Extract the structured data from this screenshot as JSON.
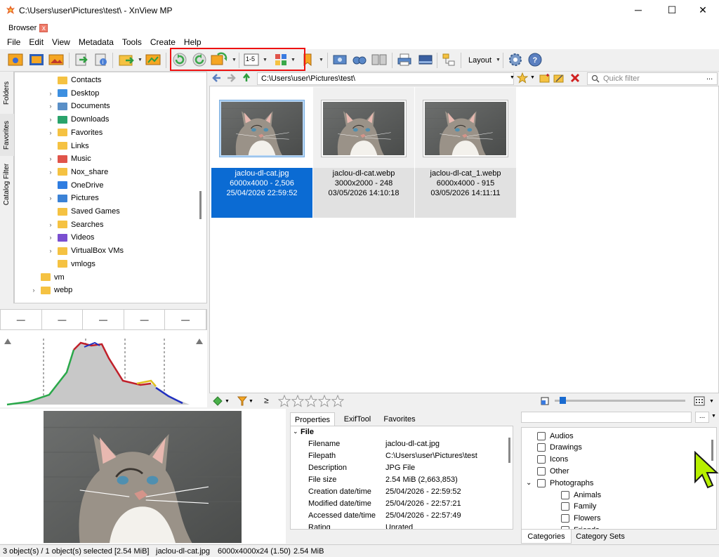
{
  "window": {
    "title": "C:\\Users\\user\\Pictures\\test\\ - XnView MP",
    "minimize": "─",
    "maximize": "☐",
    "close": "✕"
  },
  "tab": {
    "label": "Browser",
    "close": "x"
  },
  "menu": [
    "File",
    "Edit",
    "View",
    "Metadata",
    "Tools",
    "Create",
    "Help"
  ],
  "toolbar": {
    "page_label": "1-5",
    "layout_label": "Layout"
  },
  "left_tabs": [
    "Folders",
    "Favorites",
    "Catalog Filter"
  ],
  "folder_tree": [
    {
      "label": "Contacts",
      "icon": "folder-icon",
      "color": "#f5c242",
      "chevron": ""
    },
    {
      "label": "Desktop",
      "icon": "folder-icon",
      "color": "#3d8fe0",
      "chevron": "›"
    },
    {
      "label": "Documents",
      "icon": "folder-icon",
      "color": "#5a8fc7",
      "chevron": "›"
    },
    {
      "label": "Downloads",
      "icon": "folder-icon",
      "color": "#2aa36b",
      "chevron": "›"
    },
    {
      "label": "Favorites",
      "icon": "folder-icon",
      "color": "#f5c242",
      "chevron": "›"
    },
    {
      "label": "Links",
      "icon": "folder-icon",
      "color": "#f5c242",
      "chevron": ""
    },
    {
      "label": "Music",
      "icon": "folder-icon",
      "color": "#e0544a",
      "chevron": "›"
    },
    {
      "label": "Nox_share",
      "icon": "folder-icon",
      "color": "#f5c242",
      "chevron": "›"
    },
    {
      "label": "OneDrive",
      "icon": "folder-icon",
      "color": "#2f7de1",
      "chevron": ""
    },
    {
      "label": "Pictures",
      "icon": "folder-icon",
      "color": "#3b82d6",
      "chevron": "›"
    },
    {
      "label": "Saved Games",
      "icon": "folder-icon",
      "color": "#f5c242",
      "chevron": ""
    },
    {
      "label": "Searches",
      "icon": "folder-icon",
      "color": "#f5c242",
      "chevron": "›"
    },
    {
      "label": "Videos",
      "icon": "folder-icon",
      "color": "#7a4fd0",
      "chevron": "›"
    },
    {
      "label": "VirtualBox VMs",
      "icon": "folder-icon",
      "color": "#f5c242",
      "chevron": "›"
    },
    {
      "label": "vmlogs",
      "icon": "folder-icon",
      "color": "#f5c242",
      "chevron": ""
    },
    {
      "label": "vm",
      "icon": "folder-icon",
      "color": "#f5c242",
      "chevron": ""
    },
    {
      "label": "webp",
      "icon": "folder-icon",
      "color": "#f5c242",
      "chevron": "›"
    }
  ],
  "histogram_header": [
    "—",
    "—",
    "—",
    "—",
    "—"
  ],
  "address": {
    "path": "C:\\Users\\user\\Pictures\\test\\",
    "filter_placeholder": "Quick filter",
    "more": "..."
  },
  "thumbnails": [
    {
      "name": "jaclou-dl-cat.jpg",
      "dims": "6000x4000 - 2,506",
      "date": "25/04/2026 22:59:52",
      "selected": true
    },
    {
      "name": "jaclou-dl-cat.webp",
      "dims": "3000x2000 - 248",
      "date": "03/05/2026 14:10:18",
      "selected": false
    },
    {
      "name": "jaclou-dl-cat_1.webp",
      "dims": "6000x4000 - 915",
      "date": "03/05/2026 14:11:11",
      "selected": false
    }
  ],
  "rating": {
    "comparator": "≥",
    "stars": 5
  },
  "properties": {
    "tabs": [
      "Properties",
      "ExifTool",
      "Favorites"
    ],
    "section": "File",
    "rows": [
      {
        "key": "Filename",
        "value": "jaclou-dl-cat.jpg"
      },
      {
        "key": "Filepath",
        "value": "C:\\Users\\user\\Pictures\\test"
      },
      {
        "key": "Description",
        "value": "JPG File"
      },
      {
        "key": "File size",
        "value": "2.54 MiB (2,663,853)"
      },
      {
        "key": "Creation date/time",
        "value": "25/04/2026 - 22:59:52"
      },
      {
        "key": "Modified date/time",
        "value": "25/04/2026 - 22:57:21"
      },
      {
        "key": "Accessed date/time",
        "value": "25/04/2026 - 22:57:49"
      },
      {
        "key": "Rating",
        "value": "Unrated"
      }
    ]
  },
  "categories": {
    "more": "...",
    "items": [
      {
        "label": "Audios",
        "child": false,
        "expand": ""
      },
      {
        "label": "Drawings",
        "child": false,
        "expand": ""
      },
      {
        "label": "Icons",
        "child": false,
        "expand": ""
      },
      {
        "label": "Other",
        "child": false,
        "expand": ""
      },
      {
        "label": "Photographs",
        "child": false,
        "expand": "⌄"
      },
      {
        "label": "Animals",
        "child": true,
        "expand": ""
      },
      {
        "label": "Family",
        "child": true,
        "expand": ""
      },
      {
        "label": "Flowers",
        "child": true,
        "expand": ""
      },
      {
        "label": "Friends",
        "child": true,
        "expand": ""
      }
    ],
    "tabs": [
      "Categories",
      "Category Sets"
    ]
  },
  "status": {
    "count": "3 object(s) / 1 object(s) selected [2.54 MiB]",
    "file": "jaclou-dl-cat.jpg",
    "dims": "6000x4000x24 (1.50)",
    "size": "2.54 MiB"
  }
}
